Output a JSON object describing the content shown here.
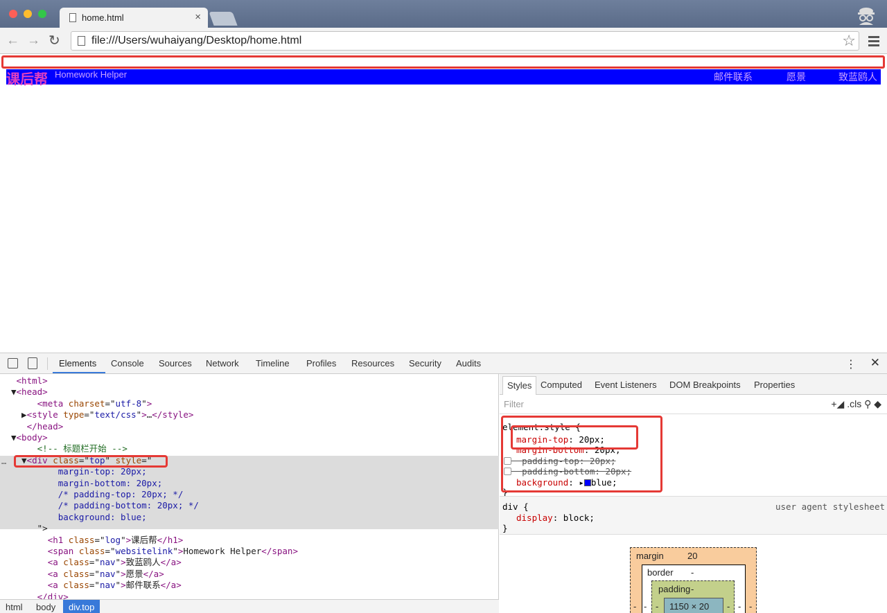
{
  "browser": {
    "tab_title": "home.html",
    "tab_close": "×",
    "url": "file:///Users/wuhaiyang/Desktop/home.html",
    "back_glyph": "←",
    "forward_glyph": "→",
    "reload_glyph": "↻",
    "star_glyph": "☆"
  },
  "page": {
    "logo": "课后帮",
    "website_link": "Homework Helper",
    "nav": [
      "邮件联系",
      "愿景",
      "致蓝鸥人"
    ],
    "topbar_color": "#0000ff"
  },
  "devtools": {
    "tabs": [
      "Elements",
      "Console",
      "Sources",
      "Network",
      "Timeline",
      "Profiles",
      "Resources",
      "Security",
      "Audits"
    ],
    "active_tab": "Elements",
    "kebab": "⋮",
    "close": "✕",
    "dom_lines": [
      {
        "indent": "",
        "arrow": "",
        "parts": [
          [
            "tag",
            "<html>"
          ]
        ]
      },
      {
        "indent": "",
        "arrow": "▼",
        "parts": [
          [
            "tag",
            "<head>"
          ]
        ]
      },
      {
        "indent": "    ",
        "arrow": "",
        "parts": [
          [
            "tag",
            "<meta "
          ],
          [
            "attr",
            "charset"
          ],
          [
            "plain",
            "=\""
          ],
          [
            "val",
            "utf-8"
          ],
          [
            "plain",
            "\""
          ],
          [
            "tag",
            ">"
          ]
        ]
      },
      {
        "indent": "  ",
        "arrow": "▶",
        "parts": [
          [
            "tag",
            "<style "
          ],
          [
            "attr",
            "type"
          ],
          [
            "plain",
            "=\""
          ],
          [
            "val",
            "text/css"
          ],
          [
            "plain",
            "\""
          ],
          [
            "tag",
            ">"
          ],
          [
            "plain",
            "…"
          ],
          [
            "tag",
            "</style>"
          ]
        ]
      },
      {
        "indent": "  ",
        "arrow": "",
        "parts": [
          [
            "tag",
            "</head>"
          ]
        ]
      },
      {
        "indent": "",
        "arrow": "▼",
        "parts": [
          [
            "tag",
            "<body>"
          ]
        ]
      },
      {
        "indent": "    ",
        "arrow": "",
        "parts": [
          [
            "comment",
            "<!-- 标题栏开始 -->"
          ]
        ]
      },
      {
        "indent": "  ",
        "arrow": "▼",
        "parts": [
          [
            "tag",
            "<div "
          ],
          [
            "attr",
            "class"
          ],
          [
            "plain",
            "=\""
          ],
          [
            "val",
            "top"
          ],
          [
            "plain",
            "\" "
          ],
          [
            "attr",
            "style"
          ],
          [
            "plain",
            "=\""
          ]
        ]
      },
      {
        "indent": "        ",
        "arrow": "",
        "parts": [
          [
            "val",
            "margin-top: 20px;"
          ]
        ]
      },
      {
        "indent": "        ",
        "arrow": "",
        "parts": [
          [
            "val",
            "margin-bottom: 20px;"
          ]
        ]
      },
      {
        "indent": "        ",
        "arrow": "",
        "parts": [
          [
            "val",
            "/* padding-top: 20px; */"
          ]
        ]
      },
      {
        "indent": "        ",
        "arrow": "",
        "parts": [
          [
            "val",
            "/* padding-bottom: 20px; */"
          ]
        ]
      },
      {
        "indent": "        ",
        "arrow": "",
        "parts": [
          [
            "val",
            "background: blue;"
          ]
        ]
      },
      {
        "indent": "    ",
        "arrow": "",
        "parts": [
          [
            "plain",
            "\">"
          ]
        ]
      },
      {
        "indent": "      ",
        "arrow": "",
        "parts": [
          [
            "tag",
            "<h1 "
          ],
          [
            "attr",
            "class"
          ],
          [
            "plain",
            "=\""
          ],
          [
            "val",
            "log"
          ],
          [
            "plain",
            "\""
          ],
          [
            "tag",
            ">"
          ],
          [
            "plain",
            "课后帮"
          ],
          [
            "tag",
            "</h1>"
          ]
        ]
      },
      {
        "indent": "      ",
        "arrow": "",
        "parts": [
          [
            "tag",
            "<span "
          ],
          [
            "attr",
            "class"
          ],
          [
            "plain",
            "=\""
          ],
          [
            "val",
            "websitelink"
          ],
          [
            "plain",
            "\""
          ],
          [
            "tag",
            ">"
          ],
          [
            "plain",
            "Homework Helper"
          ],
          [
            "tag",
            "</span>"
          ]
        ]
      },
      {
        "indent": "      ",
        "arrow": "",
        "parts": [
          [
            "tag",
            "<a "
          ],
          [
            "attr",
            "class"
          ],
          [
            "plain",
            "=\""
          ],
          [
            "val",
            "nav"
          ],
          [
            "plain",
            "\""
          ],
          [
            "tag",
            ">"
          ],
          [
            "plain",
            "致蓝鸥人"
          ],
          [
            "tag",
            "</a>"
          ]
        ]
      },
      {
        "indent": "      ",
        "arrow": "",
        "parts": [
          [
            "tag",
            "<a "
          ],
          [
            "attr",
            "class"
          ],
          [
            "plain",
            "=\""
          ],
          [
            "val",
            "nav"
          ],
          [
            "plain",
            "\""
          ],
          [
            "tag",
            ">"
          ],
          [
            "plain",
            "愿景"
          ],
          [
            "tag",
            "</a>"
          ]
        ]
      },
      {
        "indent": "      ",
        "arrow": "",
        "parts": [
          [
            "tag",
            "<a "
          ],
          [
            "attr",
            "class"
          ],
          [
            "plain",
            "=\""
          ],
          [
            "val",
            "nav"
          ],
          [
            "plain",
            "\""
          ],
          [
            "tag",
            ">"
          ],
          [
            "plain",
            "邮件联系"
          ],
          [
            "tag",
            "</a>"
          ]
        ]
      },
      {
        "indent": "    ",
        "arrow": "",
        "parts": [
          [
            "tag",
            "</div>"
          ]
        ]
      }
    ],
    "ellipsis": "…",
    "breadcrumbs": [
      "html",
      "body",
      "div.top"
    ],
    "styles_tabs": [
      "Styles",
      "Computed",
      "Event Listeners",
      "DOM Breakpoints",
      "Properties"
    ],
    "filter_placeholder": "Filter",
    "filter_tools": "+◢ .cls  ⚲  ◆",
    "element_style": {
      "selector": "element.style {",
      "rules": [
        {
          "prop": "margin-top",
          "value": "20px;",
          "struck": false,
          "checkbox": false
        },
        {
          "prop": "margin-bottom",
          "value": "20px;",
          "struck": false,
          "checkbox": false
        },
        {
          "prop": "padding-top",
          "value": "20px;",
          "struck": true,
          "checkbox": true
        },
        {
          "prop": "padding-bottom",
          "value": "20px;",
          "struck": true,
          "checkbox": true
        },
        {
          "prop": "background",
          "value": "blue;",
          "struck": false,
          "checkbox": false,
          "swatch": true
        }
      ],
      "close": "}"
    },
    "ua_rule": {
      "selector": "div {",
      "source": "user agent stylesheet",
      "prop": "display",
      "value": "block;",
      "close": "}"
    },
    "box_model": {
      "margin_label": "margin",
      "margin_value": "20",
      "border_label": "border",
      "border_value": "-",
      "padding_label": "padding",
      "padding_value": "-",
      "content": "1150 × 20",
      "side_dash": "-"
    }
  }
}
